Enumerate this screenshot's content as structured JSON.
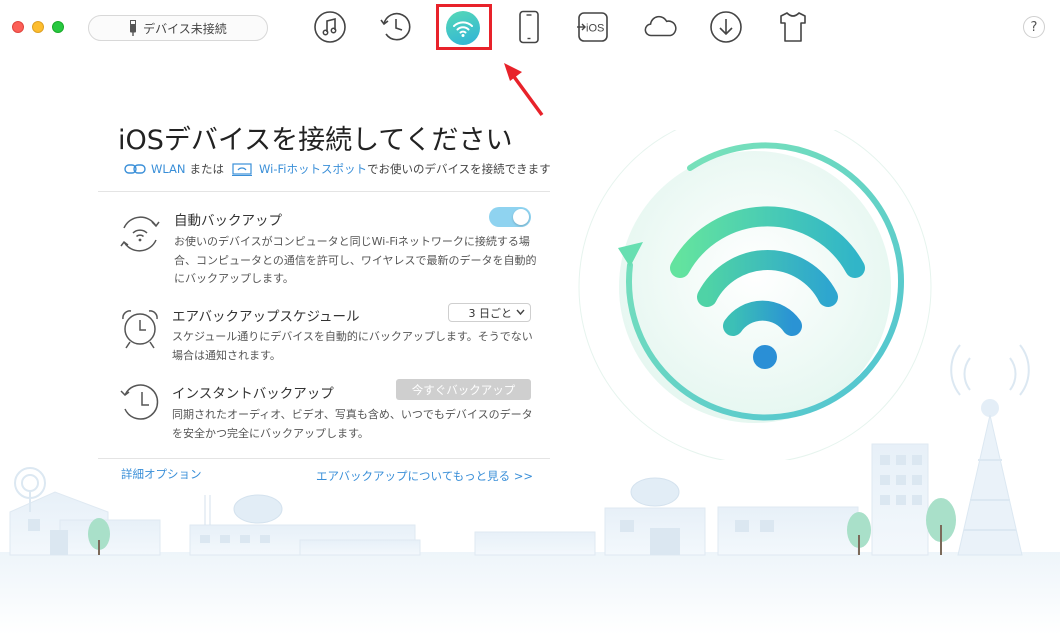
{
  "toolbar": {
    "device_label": "デバイス未接続",
    "help_label": "?",
    "items": [
      {
        "name": "music",
        "icon": "music-note-icon"
      },
      {
        "name": "history",
        "icon": "clock-history-icon"
      },
      {
        "name": "air-backup",
        "icon": "wifi-icon",
        "selected": true
      },
      {
        "name": "device",
        "icon": "phone-icon"
      },
      {
        "name": "to-ios",
        "icon": "to-ios-icon",
        "label": "iOS"
      },
      {
        "name": "icloud",
        "icon": "cloud-icon"
      },
      {
        "name": "download",
        "icon": "download-icon"
      },
      {
        "name": "tshirt",
        "icon": "tshirt-icon"
      }
    ]
  },
  "main": {
    "title": "iOSデバイスを接続してください",
    "subtitle": {
      "wlan": "WLAN",
      "or": "または",
      "hotspot": "Wi-Fiホットスポット",
      "tail": "でお使いのデバイスを接続できます"
    },
    "features": [
      {
        "title": "自動バックアップ",
        "desc": "お使いのデバイスがコンピュータと同じWi-Fiネットワークに接続する場合、コンピュータとの通信を許可し、ワイヤレスで最新のデータを自動的にバックアップします。",
        "toggle_on": true
      },
      {
        "title": "エアバックアップスケジュール",
        "desc": "スケジュール通りにデバイスを自動的にバックアップします。そうでない場合は通知されます。",
        "select_value": "3 日ごと"
      },
      {
        "title": "インスタントバックアップ",
        "desc": "同期されたオーディオ、ビデオ、写真も含め、いつでもデバイスのデータを安全かつ完全にバックアップします。",
        "button": "今すぐバックアップ"
      }
    ],
    "advanced_link": "詳細オプション",
    "more_link": "エアバックアップについてもっと見る >>"
  },
  "colors": {
    "accent_blue": "#3a8fd8",
    "annotation_red": "#e8222a",
    "wifi_green": "#5fdc9e",
    "wifi_blue": "#2a8fd6"
  }
}
